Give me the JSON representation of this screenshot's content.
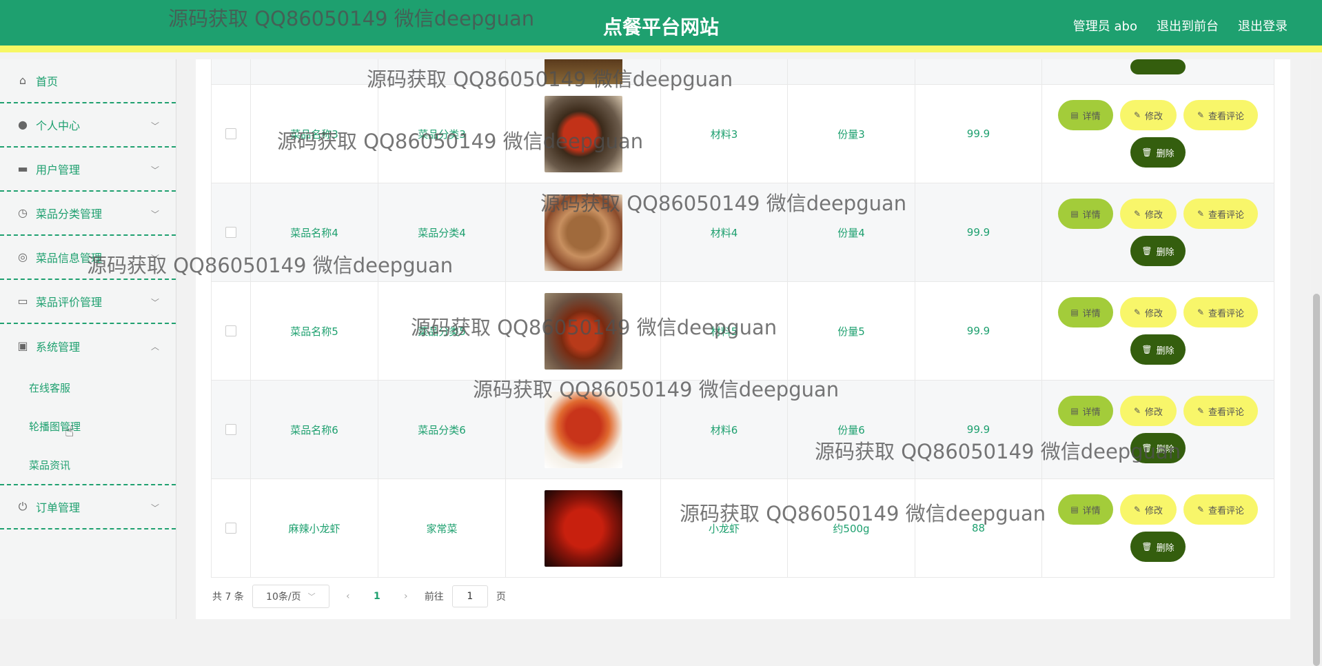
{
  "header": {
    "title": "点餐平台网站",
    "admin_label": "管理员 abo",
    "to_front_label": "退出到前台",
    "logout_label": "退出登录"
  },
  "sidebar": {
    "items": [
      {
        "label": "首页",
        "icon": "home-icon"
      },
      {
        "label": "个人中心",
        "icon": "user-icon"
      },
      {
        "label": "用户管理",
        "icon": "monitor-icon"
      },
      {
        "label": "菜品分类管理",
        "icon": "clock-icon"
      },
      {
        "label": "菜品信息管理",
        "icon": "compass-icon"
      },
      {
        "label": "菜品评价管理",
        "icon": "card-icon"
      },
      {
        "label": "系统管理",
        "icon": "wallet-icon"
      },
      {
        "label": "订单管理",
        "icon": "power-icon"
      }
    ],
    "sub_items": [
      "在线客服",
      "轮播图管理",
      "菜品资讯"
    ]
  },
  "table": {
    "rows": [
      {
        "name": "菜品名称3",
        "category": "菜品分类3",
        "material": "材料3",
        "portion": "份量3",
        "price": "99.9"
      },
      {
        "name": "菜品名称4",
        "category": "菜品分类4",
        "material": "材料4",
        "portion": "份量4",
        "price": "99.9"
      },
      {
        "name": "菜品名称5",
        "category": "菜品分类5",
        "material": "材料5",
        "portion": "份量5",
        "price": "99.9"
      },
      {
        "name": "菜品名称6",
        "category": "菜品分类6",
        "material": "材料6",
        "portion": "份量6",
        "price": "99.9"
      },
      {
        "name": "麻辣小龙虾",
        "category": "家常菜",
        "material": "小龙虾",
        "portion": "约500g",
        "price": "88"
      }
    ],
    "actions": {
      "detail": "详情",
      "edit": "修改",
      "review": "查看评论",
      "delete": "删除"
    }
  },
  "pagination": {
    "total": "共 7 条",
    "page_size": "10条/页",
    "current": "1",
    "goto_prefix": "前往",
    "goto_value": "1",
    "goto_suffix": "页"
  },
  "watermark": "源码获取 QQ86050149 微信deepguan",
  "colors": {
    "primary": "#1ea06f",
    "accent_yellow": "#f7f763",
    "detail_green": "#a3cc3a",
    "delete_dark": "#345e0e"
  }
}
